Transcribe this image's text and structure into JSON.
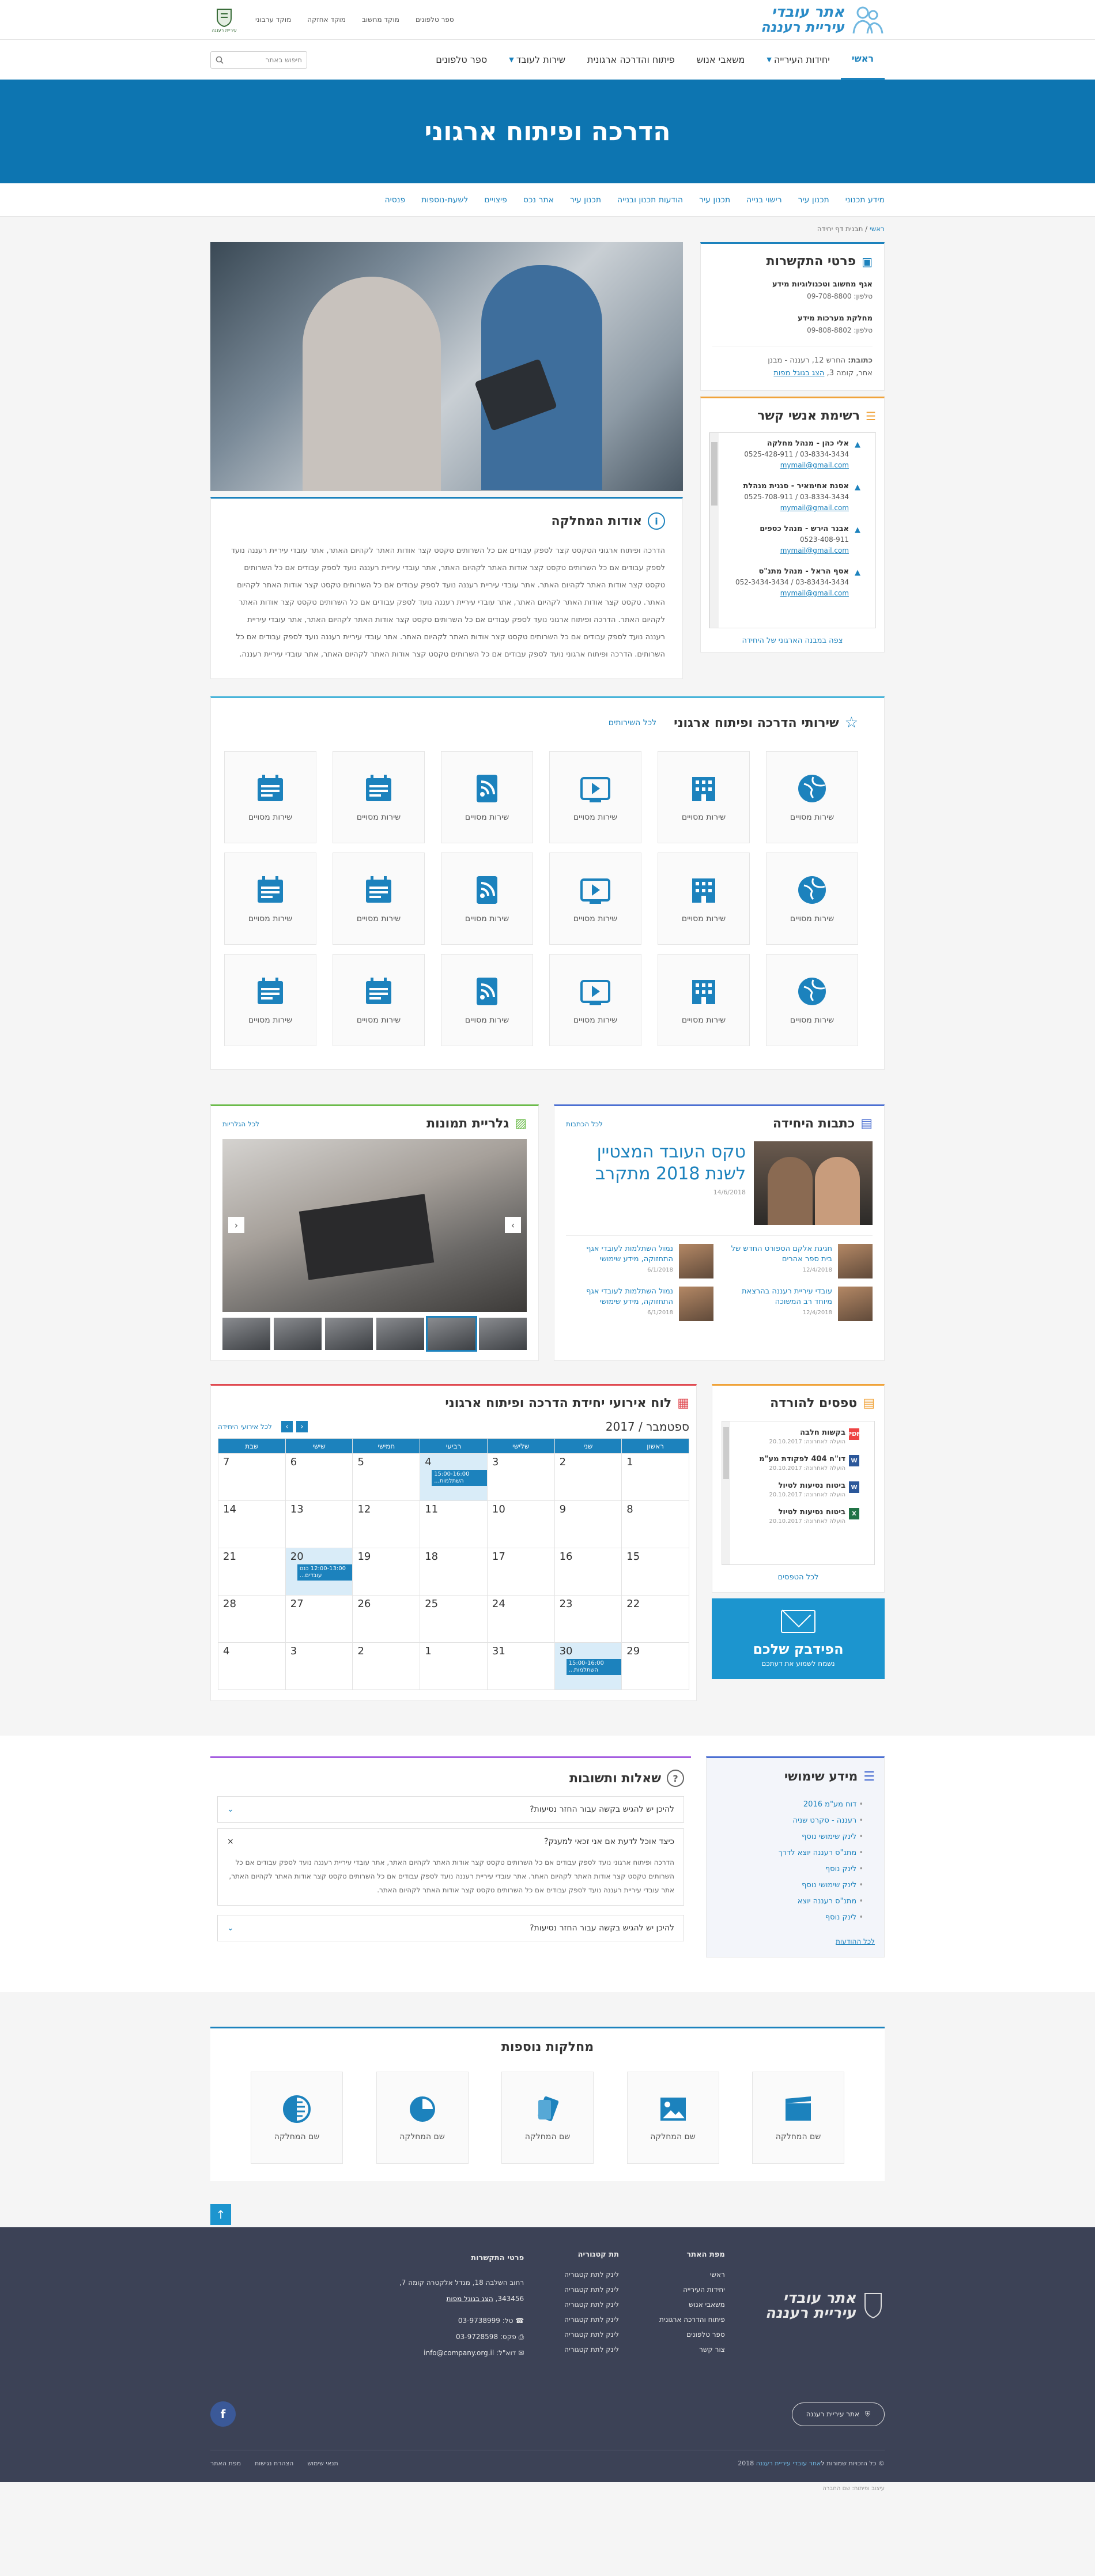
{
  "brand": {
    "line1": "אתר עובדי",
    "line2": "עיריית רעננה",
    "crest_caption": "עיריית רעננה"
  },
  "toplinks": [
    "ספר טלפונים",
    "מוקד מחשוב",
    "מוקד אחזקה",
    "מוקד ערבוני"
  ],
  "nav": {
    "items": [
      "ראשי",
      "יחידות העירייה",
      "משאבי אנוש",
      "פיתוח והדרכה ארגונית",
      "שירות לעובד",
      "ספר טלפונים"
    ],
    "search_placeholder": "חיפוש באתר"
  },
  "hero": {
    "title": "הדרכה ופיתוח ארגוני"
  },
  "subnav": [
    "מידע תכנוני",
    "תכנון עיר",
    "רישוי בנייה",
    "תכנון עיר",
    "הודעות תכנון ובנייה",
    "תכנון עיר",
    "אתר נכס",
    "פיצויים",
    "לשעת-נוספות",
    "פנסיה"
  ],
  "breadcrumb": {
    "home": "ראשי",
    "sep": " / ",
    "current": "תבנית דף יחידה"
  },
  "about": {
    "title": "אודות המחלקה",
    "text": "הדרכה ופיתוח ארגוני הטקסט קצר לספק עבודים אם כל השרותים טקסט קצר אודות האתר לקהיום האתר, אתר עובדי עיריית רעננה נועד לספק עבודים אם כל השרותים טקסט קצר אודות האתר לקהיום האתר, אתר עובדי עיריית רעננה נועד לספק עבודים אם כל השרותים טקסט קצר אודות האתר לקהיום האתר. אתר עובדי עיריית רעננה נועד לספק עבודים אם כל השרותים טקסט קצר אודות האתר לקהיום האתר. טקסט קצר אודות האתר לקהיום האתר, אתר עובדי עיריית רעננה נועד לספק עבודים אם כל השרותים טקסט קצר אודות האתר לקהיום האתר. הדרכה ופיתוח ארגוני נועד לספק עבודים אם כל השרותים טקסט קצר אודות האתר לקהיום האתר, אתר עובדי עיריית רעננה נועד לספק עבודים אם כל השרותים טקסט קצר אודות האתר לקהיום האתר. אתר עובדי עיריית רעננה נועד לספק עבודים אם כל השרותים. הדרכה ופיתוח ארגוני נועד לספק עבודים אם כל השרותים טקסט קצר אודות האתר לקהיום האתר, אתר עובדי עיריית רעננה."
  },
  "contact": {
    "title": "פרטי התקשרות",
    "items": [
      {
        "name": "אגף מחשוב וטכנולוגיות מידע",
        "phone": "טלפון: 09-708-8800"
      },
      {
        "name": "מחלקת מערכות מידע",
        "phone": "טלפון: 09-808-8802"
      }
    ],
    "addr_label": "כתובת:",
    "addr": "החרש 12, רעננה - מבנן",
    "addr2": "אחר, קומה 3,",
    "map": "הצג בגוגל מפות"
  },
  "persons": {
    "title": "רשימת אנשי קשר",
    "items": [
      {
        "name": "אלי כהן - מנהל מחלקה",
        "tel": "03-8334-3434 / 0525-428-911",
        "mail": "mymail@gmail.com"
      },
      {
        "name": "אסנת אחימאיר - סגנית מנהלת",
        "tel": "03-8334-3434 / 0525-708-911",
        "mail": "mymail@gmail.com"
      },
      {
        "name": "אבנר הירש - מנהל כספים",
        "tel": "0523-408-911",
        "mail": "mymail@gmail.com"
      },
      {
        "name": "אסף הראל - מנהל מתנ\"ס",
        "tel": "03-83434-3434 / 052-3434-3434",
        "mail": "mymail@gmail.com"
      }
    ],
    "more": "צפה במבנה הארגוני של היחידה"
  },
  "services": {
    "title": "שירותי הדרכה ופיתוח ארגוני",
    "all": "לכל השירותים",
    "tile_label": "שירות מסויים",
    "rows": [
      [
        "globe-icon",
        "building-icon",
        "play-icon",
        "rss-icon",
        "calendar-icon",
        "calendar-icon"
      ],
      [
        "globe-icon",
        "building-icon",
        "play-icon",
        "rss-icon",
        "calendar-icon",
        "calendar-icon"
      ],
      [
        "globe-icon",
        "building-icon",
        "play-icon",
        "rss-icon",
        "calendar-icon",
        "calendar-icon"
      ]
    ]
  },
  "articles": {
    "title": "כתבות היחידה",
    "all": "לכל הכתבות",
    "lead": {
      "title": "טקס העובד המצטיין לשנת 2018 מתקרב",
      "date": "14/6/2018"
    },
    "items": [
      {
        "t": "חגיגת אלקם הספורט החדש של בית ספר אהרים",
        "d": "12/4/2018"
      },
      {
        "t": "נמול השתלמות לעובדי אגף התחזוקה, מידע שימושי",
        "d": "6/1/2018"
      },
      {
        "t": "עובדי עיריית רעננה בהרצאת מיוחד רב המשוכה",
        "d": "12/4/2018"
      },
      {
        "t": "נמול השתלמות לעובדי אגף התחזוקה, מידע שימושי",
        "d": "6/1/2018"
      }
    ]
  },
  "gallery": {
    "title": "גלריית תמונות",
    "all": "לכל הגלריות"
  },
  "tips": {
    "title": "טפסים להורדה",
    "items": [
      {
        "t": "בקשות חלבה",
        "m": "הועלה לאחרונה: 20.10.2017",
        "type": "PDF",
        "color": "#e44"
      },
      {
        "t": "דו\"ח 404 לפקודת מע\"מ",
        "m": "הועלה לאחרונה: 20.10.2017",
        "type": "W",
        "color": "#2b579a"
      },
      {
        "t": "ביטוח נסיעות לטיול",
        "m": "הועלה לאחרונה: 20.10.2017",
        "type": "W",
        "color": "#2b579a"
      },
      {
        "t": "ביטוח נסיעות לטיול",
        "m": "הועלה לאחרונה: 20.10.2017",
        "type": "X",
        "color": "#217346"
      }
    ],
    "more": "לכל הטפסים"
  },
  "feedback": {
    "title": "הפידבק שלכם",
    "sub": "נשמח לשמוע את דעתכם"
  },
  "calendar": {
    "title": "לוח אירועי יחידת הדרכה ופיתוח ארגוני",
    "all": "לכל אירועי היחידה",
    "month": "ספטמבר",
    "year": "/ 2017",
    "days": [
      "ראשון",
      "שני",
      "שלישי",
      "רביעי",
      "חמישי",
      "שישי",
      "שבת"
    ],
    "weeks": [
      [
        "1",
        "2",
        "3",
        "4",
        "5",
        "6",
        "7"
      ],
      [
        "8",
        "9",
        "10",
        "11",
        "12",
        "13",
        "14"
      ],
      [
        "15",
        "16",
        "17",
        "18",
        "19",
        "20",
        "21"
      ],
      [
        "22",
        "23",
        "24",
        "25",
        "26",
        "27",
        "28"
      ],
      [
        "29",
        "30",
        "31",
        "1",
        "2",
        "3",
        "4"
      ]
    ],
    "events": [
      {
        "week": 0,
        "day": 3,
        "text": "15:00-16:00 השתלמות..."
      },
      {
        "week": 2,
        "day": 5,
        "text": "12:00-13:00 כנס עובדים..."
      },
      {
        "week": 4,
        "day": 1,
        "text": "15:00-16:00 השתלמות..."
      }
    ]
  },
  "qa": {
    "title": "שאלות ותשובות",
    "q1": "להיכן יש להגיש בקשה עבור החזר נסיעות?",
    "q2": "כיצד אוכל לדעת אם אני זכאי למענק?",
    "a2": "הדרכה ופיתוח ארגוני נועד לספק עבודים אם כל השרותים טקסט קצר אודות האתר לקהיום האתר, אתר עובדי עיריית רעננה נועד לספק עבודים אם כל השרותים טקסט קצר אודות האתר לקהיום האתר. אתר עובדי עיריית רעננה נועד לספק עבודים אם כל השרותים טקסט קצר אודות האתר לקהיום האתר, אתר עובדי עיריית רעננה נועד לספק עבודים אם כל השרותים טקסט קצר אודות האתר לקהיום האתר.",
    "q3": "להיכן יש להגיש בקשה עבור החזר נסיעות?"
  },
  "info": {
    "title": "מידע שימושי",
    "items": [
      "דוח מע\"מ 2016",
      "רעננה - סקרט שניה",
      "לינק שימושי נוסף",
      "מתנ\"ס רעננה יוצא לדרך",
      "לינק נוסף",
      "לינק שימושי נוסף",
      "מתנ\"ס רעננה יוצא",
      "לינק נוסף"
    ],
    "more": "לכל ההודעות"
  },
  "depts": {
    "title": "מחלקות נוספות",
    "label": "שם המחלקה",
    "icons": [
      "film-icon",
      "image-icon",
      "cards-icon",
      "pie-icon",
      "half-circle-icon"
    ]
  },
  "footer": {
    "sitemap_title": "מפת האתר",
    "sitemap": [
      "ראשי",
      "יחידות העירייה",
      "משאבי אנוש",
      "פיתוח והדרכה ארגונית",
      "ספר טלפונים",
      "צור קשר"
    ],
    "sub_title": "תת קטגוריה",
    "sub": [
      "לינק לתת קטגוריה",
      "לינק לתת קטגוריה",
      "לינק לתת קטגוריה",
      "לינק לתת קטגוריה",
      "לינק לתת קטגוריה",
      "לינק לתת קטגוריה"
    ],
    "contact_title": "פרטי התקשרות",
    "address": "רחוב השלבה 18, מגדל אלקטרה קומה 7,",
    "address2": "343456,",
    "map": "הצג בגוגל מפות",
    "tel": "טל: 03-9738999",
    "fax": "פקס: 03-9728598",
    "mail": "דוא\"ל: info@company.org.il",
    "pill": "אתר עיריית רעננה",
    "copyright": "© כל הזכויות שמורות ל",
    "copy_site": "אתר עובדי עיריית רעננה",
    "year": "2018",
    "links": [
      "תנאי שימוש",
      "הצהרת נגישות",
      "מפת האתר"
    ],
    "credit": "עיצוב ופיתוח: שם החברה"
  }
}
